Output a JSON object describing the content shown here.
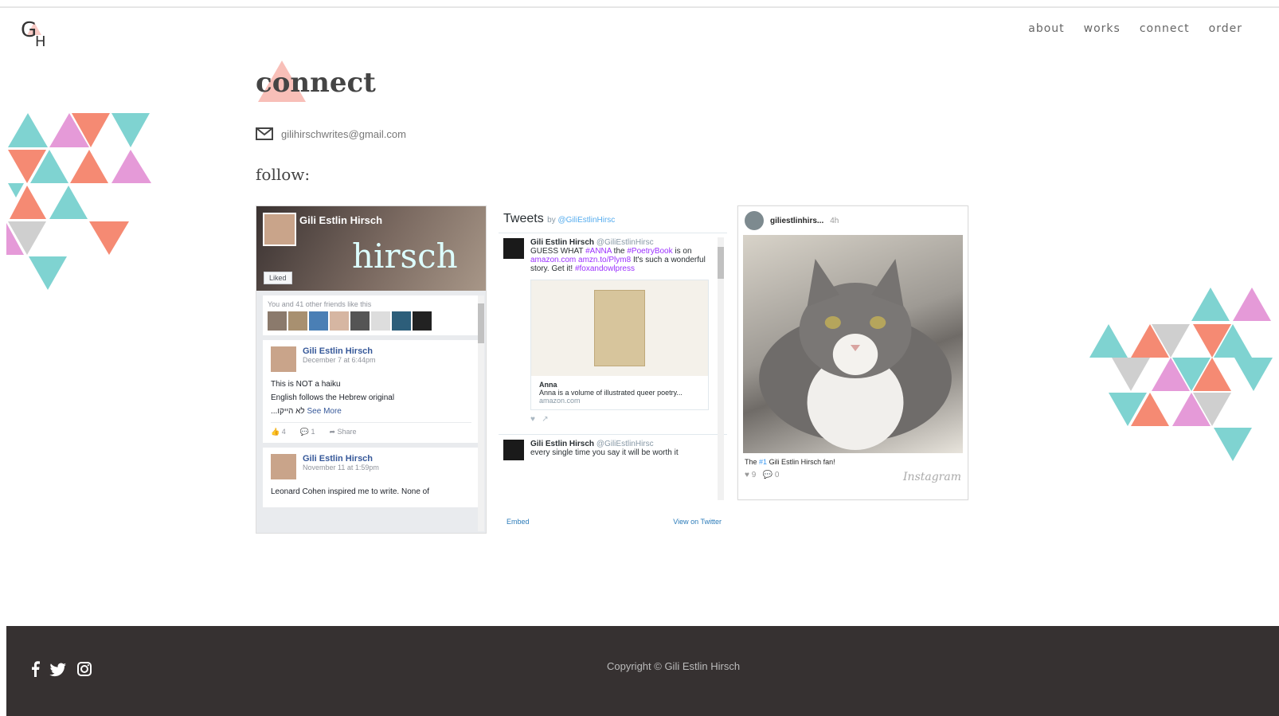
{
  "header": {
    "logo_text": "GH",
    "nav": [
      "about",
      "works",
      "connect",
      "order"
    ]
  },
  "main": {
    "title": "connect",
    "email": "gilihirschwrites@gmail.com",
    "follow_label": "follow:"
  },
  "facebook": {
    "page_name": "Gili Estlin Hirsch",
    "cover_text": "hirsch",
    "liked_label": "Liked",
    "friends_text": "You and 41 other friends like this",
    "posts": [
      {
        "author": "Gili Estlin Hirsch",
        "date": "December 7 at 6:44pm",
        "lines": [
          "This is NOT a haiku",
          "English follows the Hebrew original",
          "...לא הייקו"
        ],
        "see_more": "See More",
        "likes": "4",
        "comments": "1",
        "share": "Share"
      },
      {
        "author": "Gili Estlin Hirsch",
        "date": "November 11 at 1:59pm",
        "lines": [
          "Leonard Cohen inspired me to write. None of"
        ]
      }
    ]
  },
  "twitter": {
    "title": "Tweets",
    "by": "by",
    "handle": "@GiliEstlinHirsc",
    "tweets": [
      {
        "author": "Gili Estlin Hirsch",
        "handle": "@GiliEstlinHirsc",
        "text_a": "GUESS WHAT",
        "tag1": "#ANNA",
        "text_b": "the",
        "tag2": "#PoetryBook",
        "text_c": "is on",
        "link1": "amazon.com",
        "link2": "amzn.to/Plym8",
        "text_d": "It's such a wonderful story. Get it!",
        "tag3": "#foxandowlpress",
        "card_title": "Anna",
        "card_desc": "Anna is a volume of illustrated queer poetry...",
        "card_domain": "amazon.com"
      },
      {
        "author": "Gili Estlin Hirsch",
        "handle": "@GiliEstlinHirsc",
        "text": "every single time you say it will be worth it"
      }
    ],
    "embed": "Embed",
    "view_on": "View on Twitter"
  },
  "instagram": {
    "username": "giliestlinhirs...",
    "time": "4h",
    "caption_a": "The",
    "caption_tag": "#1",
    "caption_b": "Gili Estlin Hirsch fan!",
    "likes": "9",
    "comments": "0",
    "brand": "Instagram"
  },
  "footer": {
    "copyright": "Copyright © Gili Estlin Hirsch",
    "socials": [
      "facebook-icon",
      "twitter-icon",
      "instagram-icon"
    ]
  },
  "colors": {
    "pink": "#f5a9a0",
    "teal": "#7fd3d1",
    "coral": "#f58a73",
    "magenta": "#e59ad8",
    "grey": "#cfcfcf",
    "footer": "#363131"
  }
}
